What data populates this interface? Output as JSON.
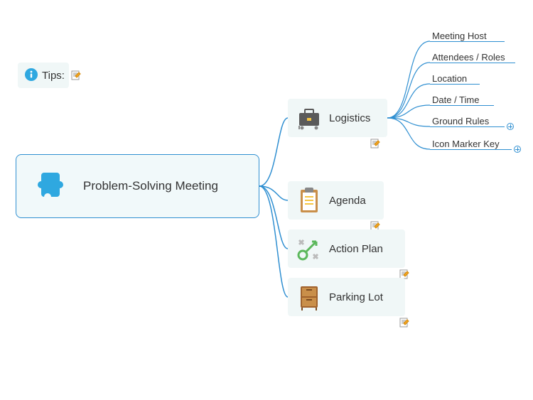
{
  "tips": {
    "label": "Tips:"
  },
  "root": {
    "label": "Problem-Solving Meeting"
  },
  "branches": {
    "logistics": {
      "label": "Logistics"
    },
    "agenda": {
      "label": "Agenda"
    },
    "actionplan": {
      "label": "Action Plan"
    },
    "parkinglot": {
      "label": "Parking Lot"
    }
  },
  "leaves": {
    "l1": "Meeting Host",
    "l2": "Attendees / Roles",
    "l3": "Location",
    "l4": "Date / Time",
    "l5": "Ground Rules",
    "l6": "Icon Marker Key"
  }
}
